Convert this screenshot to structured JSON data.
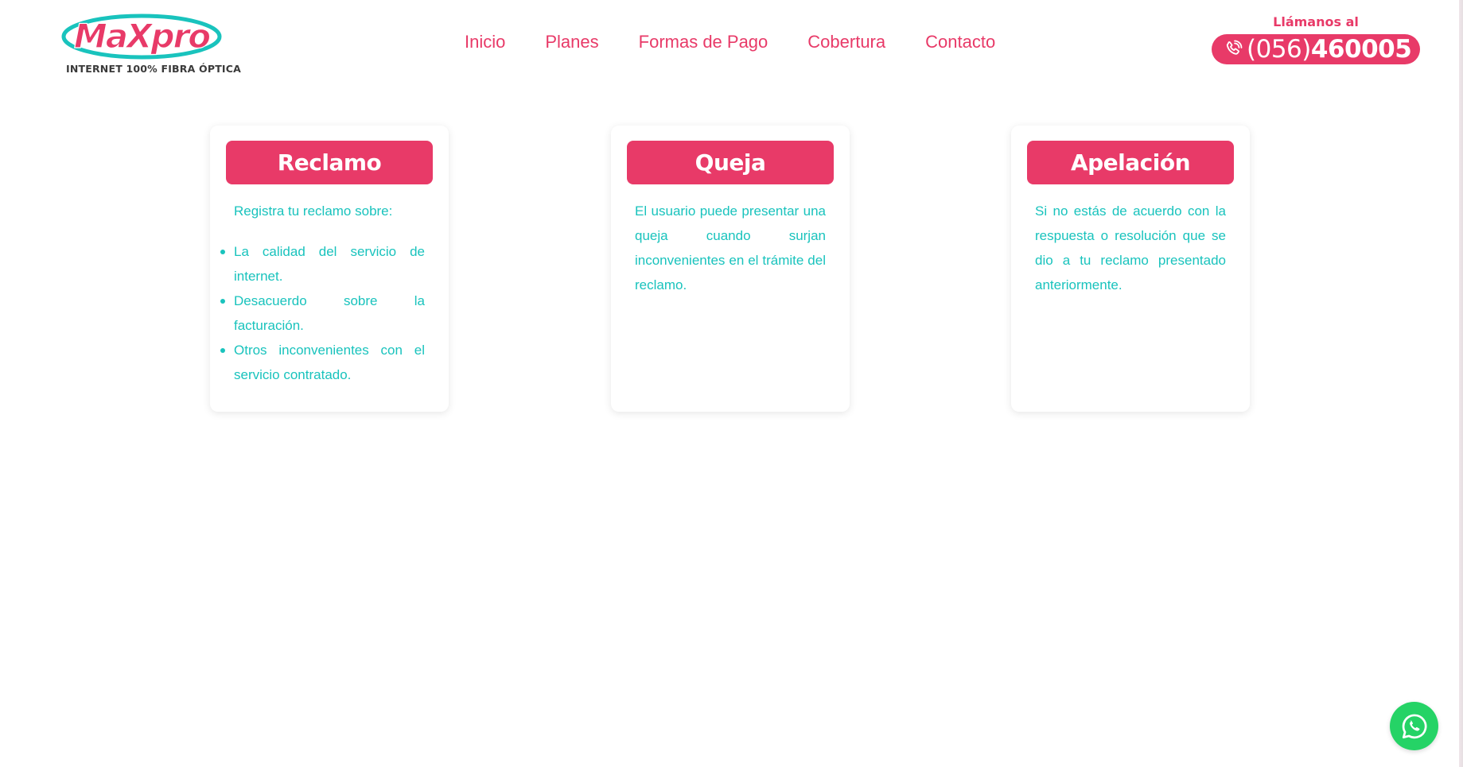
{
  "brand": {
    "logo_text": "MaXpro",
    "tagline": "INTERNET 100% FIBRA ÓPTICA",
    "primary_color": "#e83a68",
    "accent_color": "#19c3bd"
  },
  "nav": {
    "items": [
      {
        "label": "Inicio"
      },
      {
        "label": "Planes"
      },
      {
        "label": "Formas de Pago"
      },
      {
        "label": "Cobertura"
      },
      {
        "label": "Contacto"
      }
    ]
  },
  "phone": {
    "caption": "Llámanos al",
    "prefix": "(056)",
    "number": "460005",
    "icon": "phone-ring-icon"
  },
  "cards": [
    {
      "title": "Reclamo",
      "intro": "Registra tu reclamo sobre:",
      "items": [
        "La calidad del servicio de internet.",
        "Desacuerdo sobre la facturación.",
        "Otros inconvenientes con el servicio contratado."
      ]
    },
    {
      "title": "Queja",
      "text": "El usuario puede presentar una queja cuando surjan inconvenientes en el trámite del reclamo."
    },
    {
      "title": "Apelación",
      "text": "Si no estás de acuerdo con la respuesta o resolución que se dio a tu reclamo presentado anteriormente."
    }
  ],
  "whatsapp": {
    "icon": "whatsapp-icon",
    "color": "#25d366"
  }
}
